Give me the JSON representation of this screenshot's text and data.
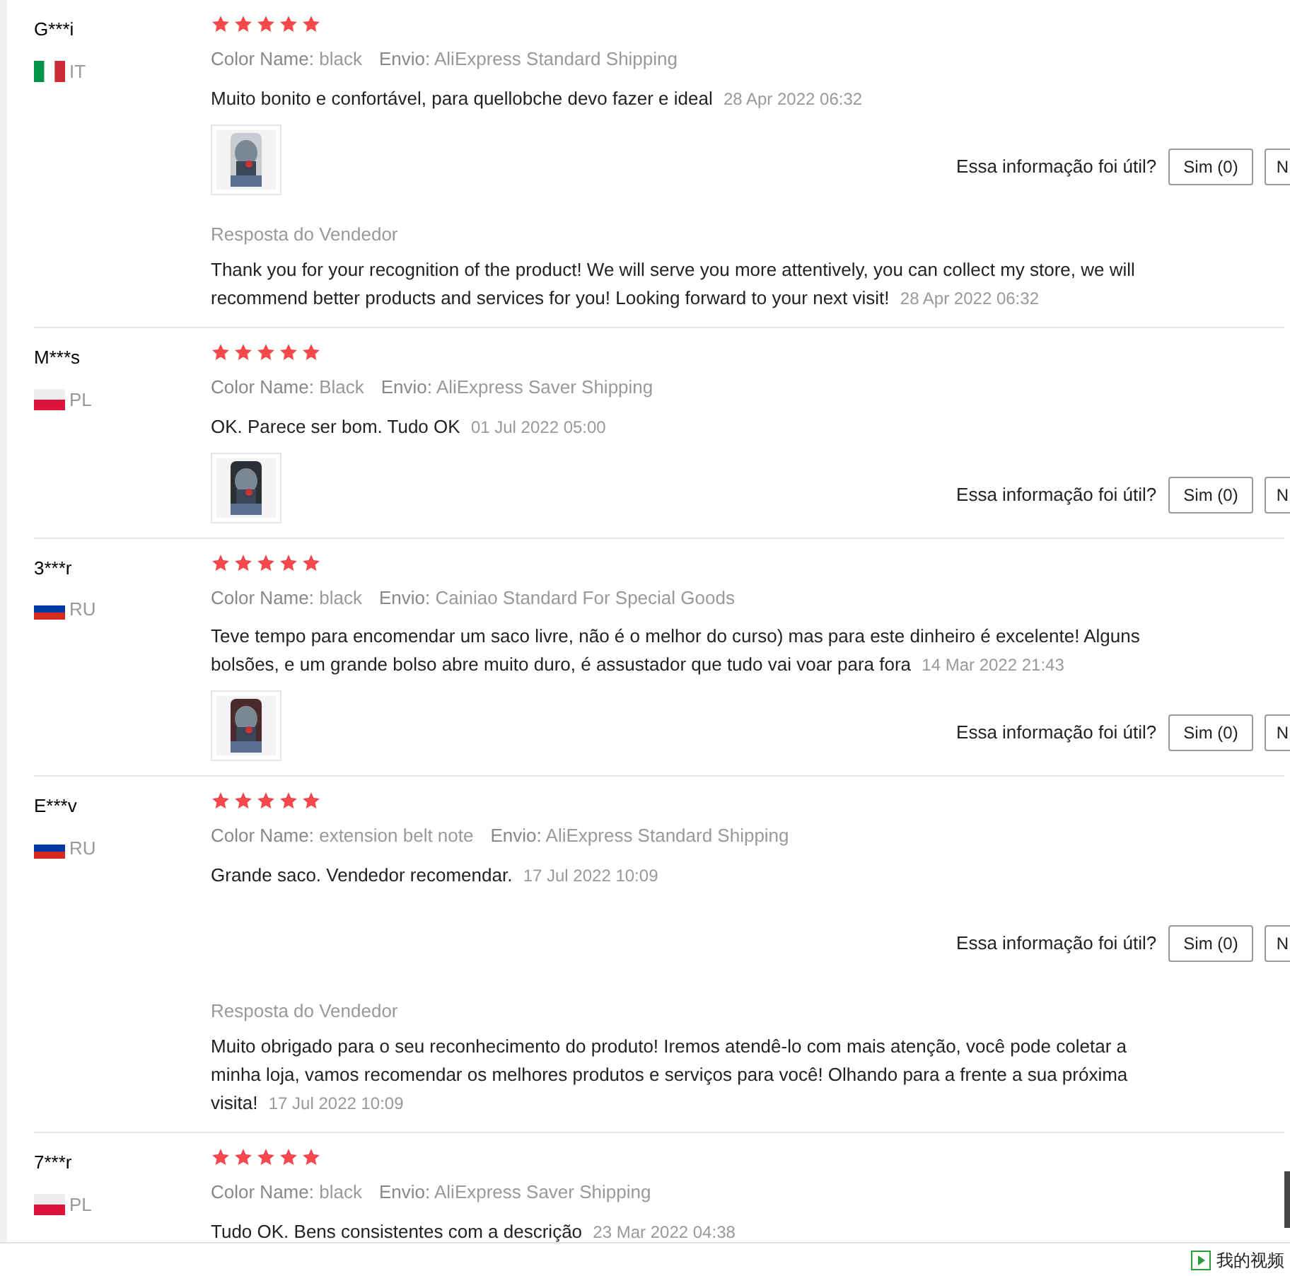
{
  "reviews": [
    {
      "user": "G***i",
      "flag": {
        "kind": "italy"
      },
      "country": "IT",
      "stars": 5,
      "color_label": "Color Name:",
      "color_value": "black",
      "ship_label": "Envio:",
      "ship_value": "AliExpress Standard Shipping",
      "text": "Muito bonito e confortável, para quellobche devo fazer e ideal",
      "date": "28 Apr 2022 06:32",
      "helpful_question": "Essa informação foi útil?",
      "yes_button": "Sim (0)",
      "no_button": "N",
      "reply": {
        "title": "Resposta do Vendedor",
        "text": "Thank you for your recognition of the product! We will serve you more attentively, you can collect my store, we will recommend better products and services for you! Looking forward to your next visit!",
        "date": "28 Apr 2022 06:32"
      }
    },
    {
      "user": "M***s",
      "flag": {
        "kind": "poland"
      },
      "country": "PL",
      "stars": 5,
      "color_label": "Color Name:",
      "color_value": "Black",
      "ship_label": "Envio:",
      "ship_value": "AliExpress Saver Shipping",
      "text": "OK. Parece ser bom. Tudo OK",
      "date": "01 Jul 2022 05:00",
      "helpful_question": "Essa informação foi útil?",
      "yes_button": "Sim (0)",
      "no_button": "N"
    },
    {
      "user": "3***r",
      "flag": {
        "kind": "russia"
      },
      "country": "RU",
      "stars": 5,
      "color_label": "Color Name:",
      "color_value": "black",
      "ship_label": "Envio:",
      "ship_value": "Cainiao Standard For Special Goods",
      "text": "Teve tempo para encomendar um saco livre, não é o melhor do curso) mas para este dinheiro é excelente! Alguns bolsões, e um grande bolso abre muito duro, é assustador que tudo vai voar para fora",
      "date": "14 Mar 2022 21:43",
      "helpful_question": "Essa informação foi útil?",
      "yes_button": "Sim (0)",
      "no_button": "N"
    },
    {
      "user": "E***v",
      "flag": {
        "kind": "russia"
      },
      "country": "RU",
      "stars": 5,
      "color_label": "Color Name:",
      "color_value": "extension belt note",
      "ship_label": "Envio:",
      "ship_value": "AliExpress Standard Shipping",
      "text": "Grande saco. Vendedor recomendar.",
      "date": "17 Jul 2022 10:09",
      "helpful_question": "Essa informação foi útil?",
      "yes_button": "Sim (0)",
      "no_button": "N",
      "reply": {
        "title": "Resposta do Vendedor",
        "text": "Muito obrigado para o seu reconhecimento do produto! Iremos atendê-lo com mais atenção, você pode coletar a minha loja, vamos recomendar os melhores produtos e serviços para você! Olhando para a frente a sua próxima visita!",
        "date": "17 Jul 2022 10:09"
      }
    },
    {
      "user": "7***r",
      "flag": {
        "kind": "poland"
      },
      "country": "PL",
      "stars": 5,
      "color_label": "Color Name:",
      "color_value": "black",
      "ship_label": "Envio:",
      "ship_value": "AliExpress Saver Shipping",
      "text": "Tudo OK. Bens consistentes com a descrição",
      "date": "23 Mar 2022 04:38"
    }
  ],
  "footer": {
    "label": "我的视频"
  }
}
